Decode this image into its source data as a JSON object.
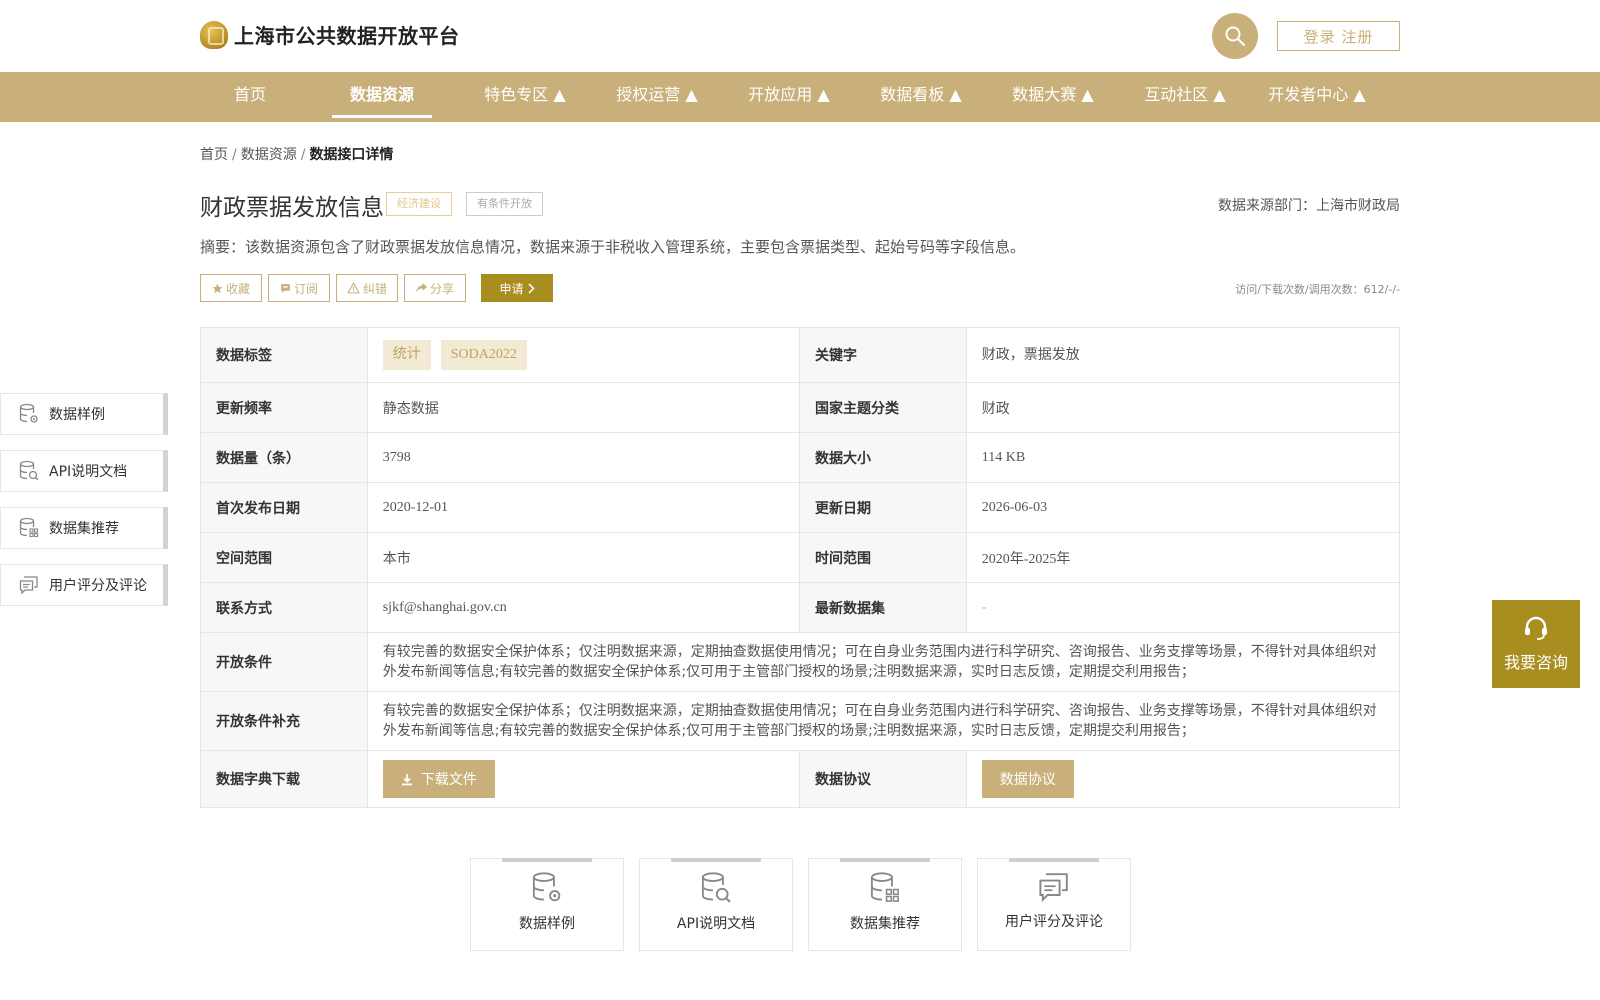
{
  "header": {
    "site_title": "上海市公共数据开放平台",
    "login_label": "登录 注册",
    "search_icon": "search-icon"
  },
  "nav": {
    "items": [
      {
        "label": "首页"
      },
      {
        "label": "数据资源"
      },
      {
        "label": "特色专区 ▲"
      },
      {
        "label": "授权运营 ▲"
      },
      {
        "label": "开放应用 ▲"
      },
      {
        "label": "数据看板 ▲"
      },
      {
        "label": "数据大赛 ▲"
      },
      {
        "label": "互动社区 ▲"
      },
      {
        "label": "开发者中心 ▲"
      }
    ],
    "active_index": 1
  },
  "breadcrumb": {
    "home": "首页",
    "sep": "/",
    "level2": "数据资源",
    "current": "数据接口详情"
  },
  "dataset": {
    "title": "财政票据发放信息",
    "tag_category": "经济建设",
    "tag_open": "有条件开放",
    "source_label": "数据来源部门：上海市财政局",
    "summary": "摘要：该数据资源包含了财政票据发放信息情况，数据来源于非税收入管理系统，主要包含票据类型、起始号码等字段信息。",
    "stats": "访问/下载次数/调用次数：612/-/-"
  },
  "actions": {
    "favorite": "收藏",
    "subscribe": "订阅",
    "report": "纠错",
    "share": "分享",
    "apply": "申请"
  },
  "table": {
    "tags_label": "数据标签",
    "tags": [
      "统计",
      "SODA2022"
    ],
    "keywords_label": "关键字",
    "keywords": "财政，票据发放",
    "freq_label": "更新频率",
    "freq": "静态数据",
    "theme_label": "国家主题分类",
    "theme": "财政",
    "count_label": "数据量（条）",
    "count": "3798",
    "size_label": "数据大小",
    "size": "114 KB",
    "first_pub_label": "首次发布日期",
    "first_pub": "2020-12-01",
    "update_label": "更新日期",
    "update": "2026-06-03",
    "space_label": "空间范围",
    "space": "本市",
    "time_label": "时间范围",
    "time": "2020年-2025年",
    "contact_label": "联系方式",
    "contact": "sjkf@shanghai.gov.cn",
    "latest_label": "最新数据集",
    "latest": "-",
    "cond_label": "开放条件",
    "cond": "有较完善的数据安全保护体系；仅注明数据来源，定期抽查数据使用情况；可在自身业务范围内进行科学研究、咨询报告、业务支撑等场景，不得针对具体组织对外发布新闻等信息;有较完善的数据安全保护体系;仅可用于主管部门授权的场景;注明数据来源，实时日志反馈，定期提交利用报告；",
    "cond_sup_label": "开放条件补充",
    "cond_sup": "有较完善的数据安全保护体系；仅注明数据来源，定期抽查数据使用情况；可在自身业务范围内进行科学研究、咨询报告、业务支撑等场景，不得针对具体组织对外发布新闻等信息;有较完善的数据安全保护体系;仅可用于主管部门授权的场景;注明数据来源，实时日志反馈，定期提交利用报告；",
    "dict_label": "数据字典下载",
    "dict_btn": "下载文件",
    "agreement_label": "数据协议",
    "agreement_btn": "数据协议"
  },
  "side_panel": [
    {
      "label": "数据样例",
      "icon": "database-gear-icon"
    },
    {
      "label": "API说明文档",
      "icon": "database-search-icon"
    },
    {
      "label": "数据集推荐",
      "icon": "database-grid-icon"
    },
    {
      "label": "用户评分及评论",
      "icon": "comment-icon"
    }
  ],
  "consult": {
    "label": "我要咨询",
    "icon": "headset-icon"
  },
  "cards": [
    {
      "label": "数据样例"
    },
    {
      "label": "API说明文档"
    },
    {
      "label": "数据集推荐"
    },
    {
      "label": "用户评分及评论"
    }
  ],
  "colors": {
    "brand_gold": "#c9b07a",
    "apply_olive": "#a88e1f",
    "chip_bg": "#f3ead5"
  }
}
